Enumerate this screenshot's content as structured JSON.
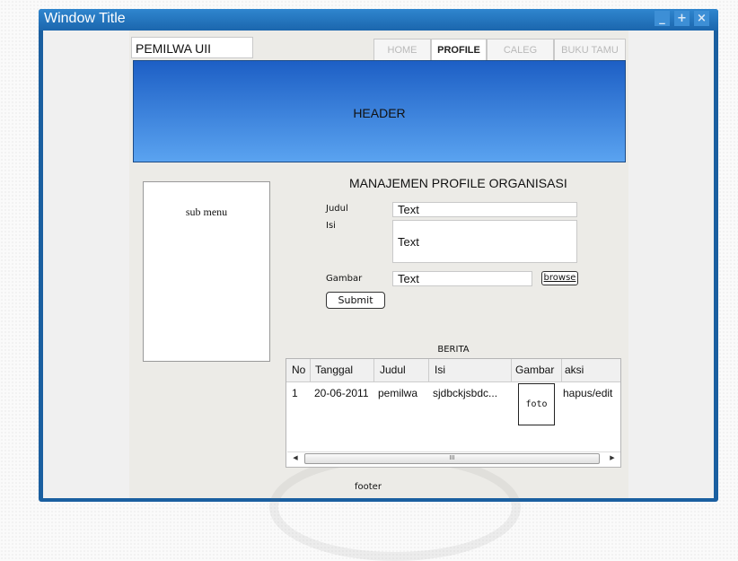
{
  "window": {
    "title": "Window Title",
    "controls": [
      "_",
      "+",
      "×"
    ]
  },
  "site": {
    "name": "PEMILWA UII"
  },
  "nav": {
    "tabs": [
      {
        "label": "HOME",
        "active": false
      },
      {
        "label": "PROFILE",
        "active": true
      },
      {
        "label": "CALEG",
        "active": false
      },
      {
        "label": "BUKU TAMU",
        "active": false
      }
    ]
  },
  "header": {
    "text": "HEADER"
  },
  "submenu": {
    "text": "sub menu"
  },
  "form": {
    "title": "MANAJEMEN PROFILE ORGANISASI",
    "judul_label": "Judul",
    "judul_value": "Text",
    "isi_label": "Isi",
    "isi_value": "Text",
    "gambar_label": "Gambar",
    "gambar_value": "Text",
    "browse_label": "browse",
    "submit_label": "Submit"
  },
  "berita": {
    "title": "BERITA",
    "columns": [
      "No",
      "Tanggal",
      "Judul",
      "Isi",
      "Gambar",
      "aksi"
    ],
    "rows": [
      {
        "no": "1",
        "tanggal": "20-06-2011",
        "judul": "pemilwa",
        "isi": "sjdbckjsbdc...",
        "gambar": "foto",
        "aksi": "hapus/edit"
      }
    ],
    "scroll_thumb": "III"
  },
  "footer": {
    "text": "footer"
  },
  "colors": {
    "titlebar": "#1b66ad",
    "header_top": "#1d5fc5",
    "header_bottom": "#5aa3f0"
  }
}
